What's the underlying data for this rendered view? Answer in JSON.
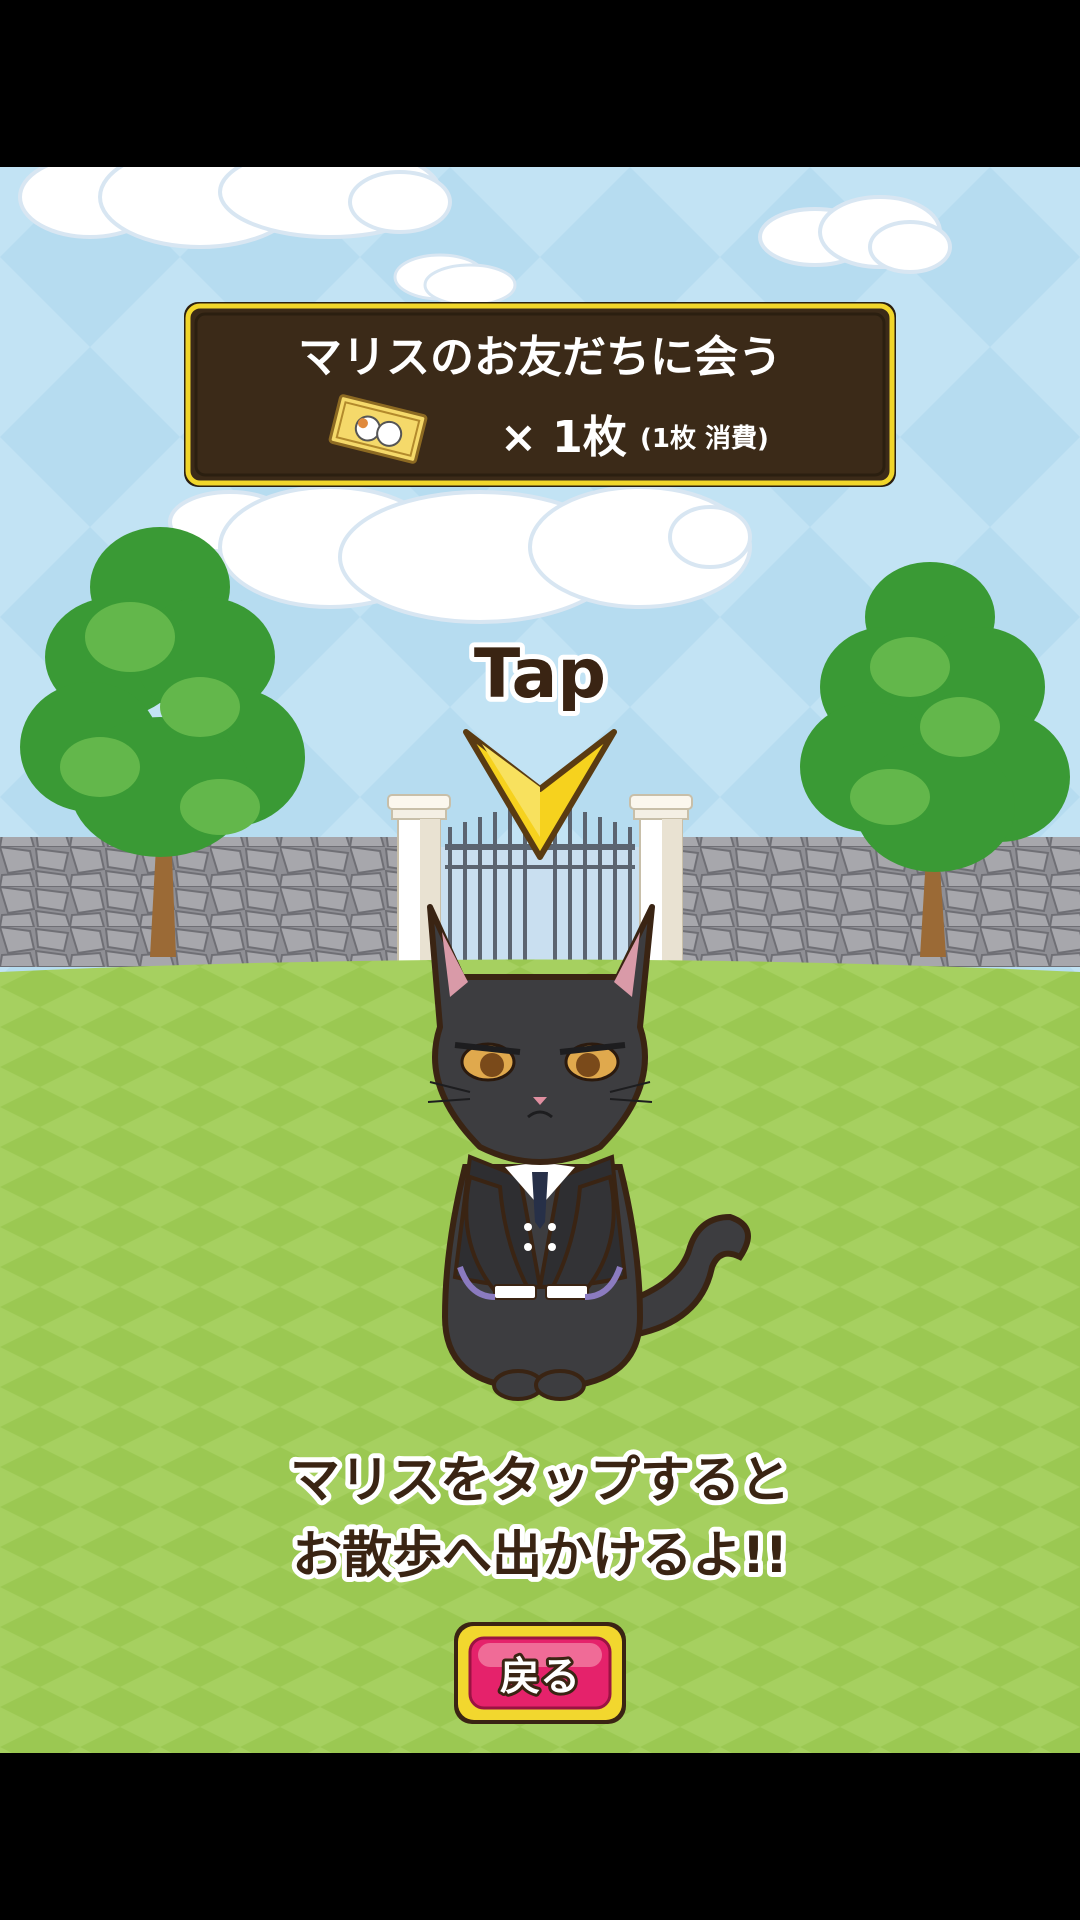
{
  "info_box": {
    "title": "マリスのお友だちに会う",
    "count": "× 1枚",
    "consume_note": "(1枚 消費)"
  },
  "tap_label": "Tap",
  "instruction": {
    "line1": "マリスをタップすると",
    "line2": "お散歩へ出かけるよ!!"
  },
  "back_button": {
    "label": "戻る"
  },
  "icons": {
    "ticket": "ticket-icon",
    "arrow": "tap-arrow-icon"
  },
  "colors": {
    "sky": "#c2e3f4",
    "grass": "#a4cf5b",
    "panel": "#3b2a18",
    "panel_border": "#f1d62b",
    "arrow": "#f6d21e",
    "button": "#e5226b",
    "button_border": "#f2d72e"
  }
}
